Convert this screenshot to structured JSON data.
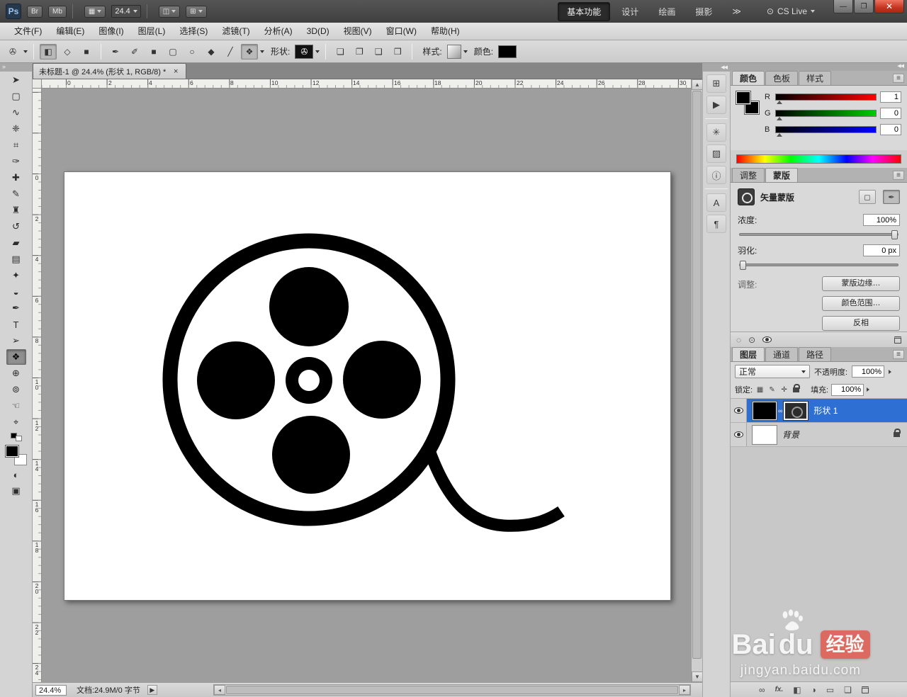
{
  "appbar": {
    "logo": "Ps",
    "br_label": "Br",
    "mb_label": "Mb",
    "zoom_value": "24.4",
    "workspaces": [
      {
        "label": "基本功能"
      },
      {
        "label": "设计"
      },
      {
        "label": "绘画"
      },
      {
        "label": "摄影"
      }
    ],
    "overflow": "≫",
    "cs_live_label": "CS Live",
    "icons": {
      "grid": "▦",
      "arrange": "◫",
      "screen": "⊞",
      "cs_dot": "⊙",
      "minimize": "—",
      "restore": "❐",
      "close": "✕"
    }
  },
  "menubar": {
    "items": [
      "文件(F)",
      "编辑(E)",
      "图像(I)",
      "图层(L)",
      "选择(S)",
      "滤镜(T)",
      "分析(A)",
      "3D(D)",
      "视图(V)",
      "窗口(W)",
      "帮助(H)"
    ]
  },
  "optionsbar": {
    "shape_label": "形状:",
    "style_label": "样式:",
    "color_label": "颜色:",
    "icons": {
      "preset": "✇",
      "shape_layers": "◧",
      "paths": "◇",
      "fill_pixels": "■",
      "pen": "✒",
      "freeform_pen": "✐",
      "rect": "■",
      "rounded": "▢",
      "ellipse": "○",
      "polygon": "◆",
      "line": "╱",
      "custom": "❖",
      "shape_thumb": "✇",
      "combine": [
        "❏",
        "❐",
        "❑",
        "❒"
      ]
    }
  },
  "document": {
    "tab_title": "未标题-1 @ 24.4% (形状 1, RGB/8) *",
    "close_glyph": "×"
  },
  "rulers": {
    "top": [
      "0",
      "2",
      "4",
      "6",
      "8",
      "10",
      "12",
      "14",
      "16",
      "18",
      "20",
      "22",
      "24",
      "26",
      "28",
      "30"
    ],
    "left": [
      "0",
      "2",
      "4",
      "6",
      "8",
      "10",
      "12",
      "14",
      "16",
      "18",
      "20",
      "22",
      "24"
    ]
  },
  "toolbox": {
    "collapse_glyph": "»",
    "tools": [
      {
        "name": "move",
        "glyph": "➤"
      },
      {
        "name": "marquee",
        "glyph": "▢"
      },
      {
        "name": "lasso",
        "glyph": "∿"
      },
      {
        "name": "quick-selection",
        "glyph": "❈"
      },
      {
        "name": "crop",
        "glyph": "⌗"
      },
      {
        "name": "eyedropper",
        "glyph": "✑"
      },
      {
        "name": "healing-brush",
        "glyph": "✚"
      },
      {
        "name": "brush",
        "glyph": "✎"
      },
      {
        "name": "clone-stamp",
        "glyph": "♜"
      },
      {
        "name": "history-brush",
        "glyph": "↺"
      },
      {
        "name": "eraser",
        "glyph": "▰"
      },
      {
        "name": "gradient",
        "glyph": "▤"
      },
      {
        "name": "blur",
        "glyph": "✦"
      },
      {
        "name": "dodge",
        "glyph": "◒"
      },
      {
        "name": "pen",
        "glyph": "✒"
      },
      {
        "name": "type",
        "glyph": "T"
      },
      {
        "name": "path-selection",
        "glyph": "➢"
      },
      {
        "name": "custom-shape",
        "glyph": "❖"
      },
      {
        "name": "3d-rotate",
        "glyph": "⊕"
      },
      {
        "name": "3d-camera",
        "glyph": "⊚"
      },
      {
        "name": "hand",
        "glyph": "☜"
      },
      {
        "name": "zoom",
        "glyph": "⌖"
      }
    ],
    "quick_mask_glyph": "◐",
    "screen_mode_glyph": "▣"
  },
  "statusbar": {
    "zoom": "24.4%",
    "doc_info": "文档:24.9M/0 字节",
    "flyout_glyph": "▶",
    "scroll_left": "◂",
    "scroll_right": "▸",
    "scroll_up": "▲",
    "scroll_down": "▼"
  },
  "panel_strip": {
    "collapse_glyph": "◀◀",
    "icons": [
      {
        "name": "navigator-panel",
        "glyph": "⊞"
      },
      {
        "name": "animation-panel",
        "glyph": "▶"
      },
      {
        "name": "adjustments-panel",
        "glyph": "✳"
      },
      {
        "name": "histogram-panel",
        "glyph": "▨"
      },
      {
        "name": "info-panel",
        "glyph": "ⓘ"
      },
      {
        "name": "character-panel",
        "glyph": "A"
      },
      {
        "name": "paragraph-panel",
        "glyph": "¶"
      }
    ]
  },
  "panels": {
    "menu_glyph": "≡",
    "color": {
      "tabs": [
        "颜色",
        "色板",
        "样式"
      ],
      "channels": [
        {
          "label": "R",
          "value": "1"
        },
        {
          "label": "G",
          "value": "0"
        },
        {
          "label": "B",
          "value": "0"
        }
      ]
    },
    "masks": {
      "tabs": [
        "调整",
        "蒙版"
      ],
      "title": "矢量蒙版",
      "pixel_mask_glyph": "◻",
      "vector_mask_glyph": "✒",
      "density_label": "浓度:",
      "density_value": "100%",
      "feather_label": "羽化:",
      "feather_value": "0 px",
      "adjust_label": "调整:",
      "mask_edge_button": "蒙版边缘…",
      "color_range_button": "颜色范围…",
      "invert_button": "反相",
      "bottom_icons": {
        "selection": "◌",
        "apply": "⊙"
      }
    },
    "layers": {
      "tabs": [
        "图层",
        "通道",
        "路径"
      ],
      "blend_mode": "正常",
      "opacity_label": "不透明度:",
      "opacity_value": "100%",
      "lock_label": "锁定:",
      "lock_icons": [
        "▦",
        "✎",
        "✛"
      ],
      "fill_label": "填充:",
      "fill_value": "100%",
      "rows": [
        {
          "name": "形状 1"
        },
        {
          "name": "背景"
        }
      ],
      "chain_glyph": "∞",
      "bottom_icons": {
        "link": "∞",
        "fx": "fx.",
        "mask": "◧",
        "adjustment": "◑",
        "group": "▭",
        "new_layer": "❏"
      }
    }
  },
  "watermark": {
    "bai": "Bai",
    "du": "du",
    "badge": "经验",
    "url": "jingyan.baidu.com"
  }
}
